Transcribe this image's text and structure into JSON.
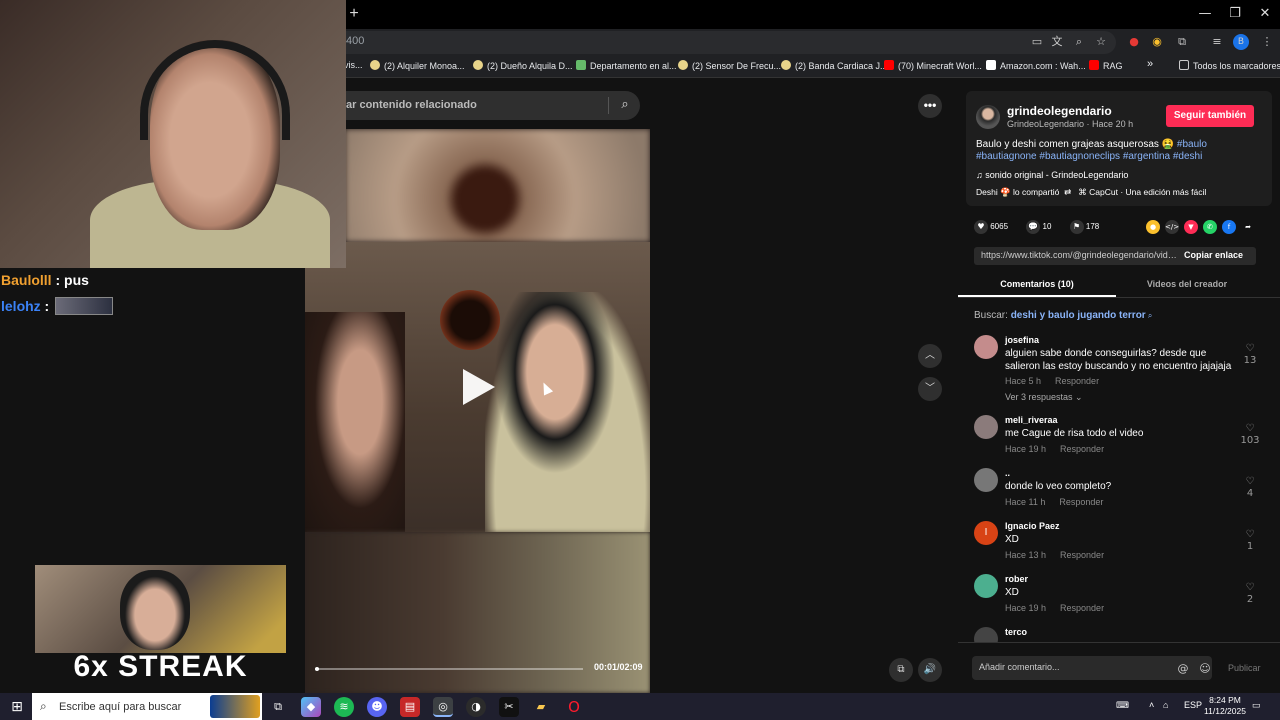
{
  "browser": {
    "new_tab_icon": "+",
    "url_fragment": "400",
    "window_controls": [
      "—",
      "❐",
      "✕"
    ],
    "bookmarks": [
      {
        "label": "vis...",
        "color": "#888888"
      },
      {
        "label": "(2) Alquiler Monoa...",
        "color": "#e8d48a"
      },
      {
        "label": "(2) Dueño Alquila D...",
        "color": "#e8d48a"
      },
      {
        "label": "Departamento en al...",
        "color": "#66bb6a"
      },
      {
        "label": "(2) Sensor De Frecu...",
        "color": "#e8d48a"
      },
      {
        "label": "(2) Banda Cardiaca J...",
        "color": "#e8d48a"
      },
      {
        "label": "(70) Minecraft Worl...",
        "color": "#ff0000"
      },
      {
        "label": "Amazon.com : Wah...",
        "color": "#ffffff"
      },
      {
        "label": "RAG",
        "color": "#ff0000"
      }
    ],
    "bookmarks_overflow": "»",
    "all_bookmarks": "Todos los marcadores",
    "profile_initial": "B"
  },
  "search": {
    "placeholder": "ar contenido relacionado"
  },
  "video": {
    "progress": 0.008,
    "time": "00:01/02:09"
  },
  "post": {
    "username": "grindeolegendario",
    "subline": "GrindeoLegendario · Hace 20 h",
    "follow_label": "Seguir también",
    "desc_text": "Baulo y deshi comen grajeas asquerosas 🤮 ",
    "hashtags": [
      "#baulo",
      "#bautiagnone",
      "#bautiagnoneclips",
      "#argentina",
      "#deshi"
    ],
    "sound": "♫ sonido original - GrindeoLegendario",
    "shared": "Deshi 🍄 lo compartió",
    "capcut": "CapCut · Una edición más fácil",
    "likes": "6065",
    "comments": "10",
    "saves": "178",
    "link": "https://www.tiktok.com/@grindeolegendario/video/...",
    "copy_label": "Copiar enlace"
  },
  "tabs": {
    "comments": "Comentarios (10)",
    "creator": "Videos del creador"
  },
  "buscar": {
    "label": "Buscar: ",
    "query": "deshi y baulo jugando terror"
  },
  "comments": [
    {
      "user": "josefina",
      "text": "alguien sabe donde conseguirlas? desde que salieron las estoy buscando y no encuentro jajajaja",
      "time": "Hace 5 h",
      "reply": "Responder",
      "likes": "13",
      "replies": "Ver 3 respuestas ⌄",
      "initial": "",
      "color": "#c48c8c"
    },
    {
      "user": "meli_riveraa",
      "text": "me Cague de risa todo el video",
      "time": "Hace 19 h",
      "reply": "Responder",
      "likes": "103",
      "replies": "",
      "initial": "",
      "color": "#8b7b7b"
    },
    {
      "user": "..",
      "text": "donde lo veo completo?",
      "time": "Hace 11 h",
      "reply": "Responder",
      "likes": "4",
      "replies": "",
      "initial": "",
      "color": "#777777"
    },
    {
      "user": "Ignacio Paez",
      "text": "XD",
      "time": "Hace 13 h",
      "reply": "Responder",
      "likes": "1",
      "replies": "",
      "initial": "I",
      "color": "#d84315"
    },
    {
      "user": "rober",
      "text": "XD",
      "time": "Hace 19 h",
      "reply": "Responder",
      "likes": "2",
      "replies": "",
      "initial": "",
      "color": "#4caf8f"
    },
    {
      "user": "terco",
      "text": "",
      "time": "",
      "reply": "",
      "likes": "",
      "replies": "",
      "initial": "",
      "color": "#444444"
    }
  ],
  "comment_box": {
    "placeholder": "Añadir comentario...",
    "publish": "Publicar"
  },
  "overlay": {
    "chat": [
      {
        "user": "Baulolll",
        "sep": " : ",
        "msg": "pus",
        "color": "#f0a030"
      },
      {
        "user": "lelohz",
        "sep": " : ",
        "msg": "",
        "color": "#3b82f6"
      }
    ],
    "streak": "6x STREAK"
  },
  "taskbar": {
    "search_placeholder": "Escribe aquí para buscar",
    "lang": "ESP",
    "time": "8:24 PM",
    "date": "11/12/2025"
  }
}
